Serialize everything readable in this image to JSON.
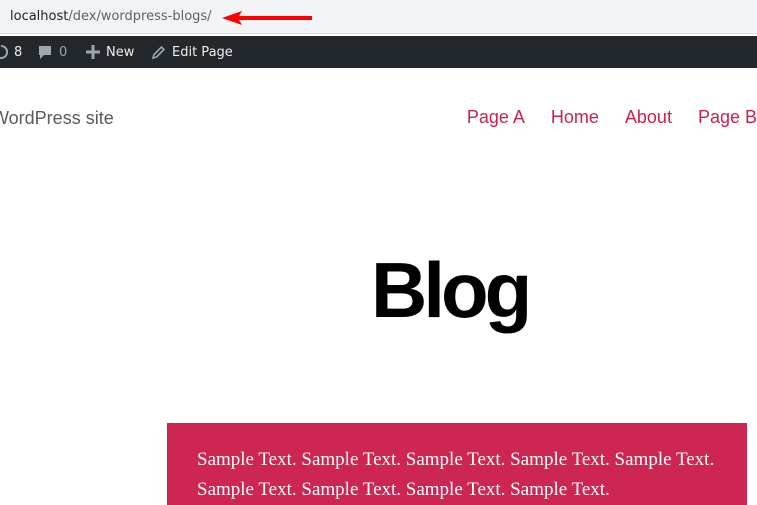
{
  "browser": {
    "url_host": "localhost",
    "url_path": "/dex/wordpress-blogs/",
    "annotation_arrow_color": "#ff0000"
  },
  "admin_bar": {
    "updates_count": "8",
    "comments_count": "0",
    "new_label": "New",
    "edit_label": "Edit Page",
    "background": "#23282d"
  },
  "site": {
    "title": "WordPress site",
    "nav": [
      "Page A",
      "Home",
      "About",
      "Page B"
    ],
    "accent": "#cd2653",
    "nav_color": "#c9224e"
  },
  "page": {
    "title": "Blog"
  },
  "content": {
    "sample_text": "Sample Text. Sample Text. Sample Text. Sample Text. Sample Text. Sample Text. Sample Text. Sample Text. Sample Text."
  }
}
